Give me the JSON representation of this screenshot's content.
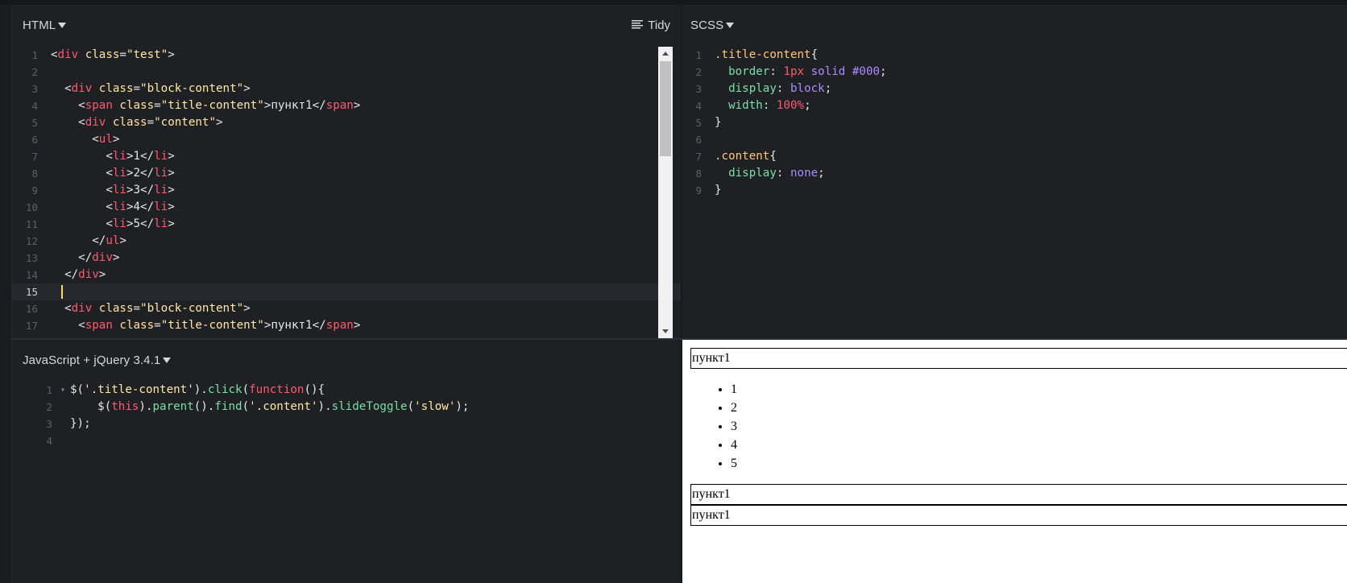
{
  "html_pane": {
    "language_label": "HTML",
    "tidy_label": "Tidy",
    "lines": [
      {
        "n": "1",
        "segs": [
          [
            "p",
            "<"
          ],
          [
            "tag",
            "div"
          ],
          [
            "attr",
            " class"
          ],
          [
            "p",
            "="
          ],
          [
            "str",
            "\"test\""
          ],
          [
            "p",
            ">"
          ]
        ]
      },
      {
        "n": "2",
        "segs": []
      },
      {
        "n": "3",
        "segs": [
          [
            "p",
            "  <"
          ],
          [
            "tag",
            "div"
          ],
          [
            "attr",
            " class"
          ],
          [
            "p",
            "="
          ],
          [
            "str",
            "\"block-content\""
          ],
          [
            "p",
            ">"
          ]
        ]
      },
      {
        "n": "4",
        "segs": [
          [
            "p",
            "    <"
          ],
          [
            "tag",
            "span"
          ],
          [
            "attr",
            " class"
          ],
          [
            "p",
            "="
          ],
          [
            "str",
            "\"title-content\""
          ],
          [
            "p",
            ">пункт1</"
          ],
          [
            "tag",
            "span"
          ],
          [
            "p",
            ">"
          ]
        ]
      },
      {
        "n": "5",
        "segs": [
          [
            "p",
            "    <"
          ],
          [
            "tag",
            "div"
          ],
          [
            "attr",
            " class"
          ],
          [
            "p",
            "="
          ],
          [
            "str",
            "\"content\""
          ],
          [
            "p",
            ">"
          ]
        ]
      },
      {
        "n": "6",
        "segs": [
          [
            "p",
            "      <"
          ],
          [
            "tag",
            "ul"
          ],
          [
            "p",
            ">"
          ]
        ]
      },
      {
        "n": "7",
        "segs": [
          [
            "p",
            "        <"
          ],
          [
            "tag",
            "li"
          ],
          [
            "p",
            ">1</"
          ],
          [
            "tag",
            "li"
          ],
          [
            "p",
            ">"
          ]
        ]
      },
      {
        "n": "8",
        "segs": [
          [
            "p",
            "        <"
          ],
          [
            "tag",
            "li"
          ],
          [
            "p",
            ">2</"
          ],
          [
            "tag",
            "li"
          ],
          [
            "p",
            ">"
          ]
        ]
      },
      {
        "n": "9",
        "segs": [
          [
            "p",
            "        <"
          ],
          [
            "tag",
            "li"
          ],
          [
            "p",
            ">3</"
          ],
          [
            "tag",
            "li"
          ],
          [
            "p",
            ">"
          ]
        ]
      },
      {
        "n": "10",
        "segs": [
          [
            "p",
            "        <"
          ],
          [
            "tag",
            "li"
          ],
          [
            "p",
            ">4</"
          ],
          [
            "tag",
            "li"
          ],
          [
            "p",
            ">"
          ]
        ]
      },
      {
        "n": "11",
        "segs": [
          [
            "p",
            "        <"
          ],
          [
            "tag",
            "li"
          ],
          [
            "p",
            ">5</"
          ],
          [
            "tag",
            "li"
          ],
          [
            "p",
            ">"
          ]
        ]
      },
      {
        "n": "12",
        "segs": [
          [
            "p",
            "      </"
          ],
          [
            "tag",
            "ul"
          ],
          [
            "p",
            ">"
          ]
        ]
      },
      {
        "n": "13",
        "segs": [
          [
            "p",
            "    </"
          ],
          [
            "tag",
            "div"
          ],
          [
            "p",
            ">"
          ]
        ]
      },
      {
        "n": "14",
        "segs": [
          [
            "p",
            "  </"
          ],
          [
            "tag",
            "div"
          ],
          [
            "p",
            ">"
          ]
        ]
      },
      {
        "n": "15",
        "segs": [],
        "active": true
      },
      {
        "n": "16",
        "segs": [
          [
            "p",
            "  <"
          ],
          [
            "tag",
            "div"
          ],
          [
            "attr",
            " class"
          ],
          [
            "p",
            "="
          ],
          [
            "str",
            "\"block-content\""
          ],
          [
            "p",
            ">"
          ]
        ]
      },
      {
        "n": "17",
        "segs": [
          [
            "p",
            "    <"
          ],
          [
            "tag",
            "span"
          ],
          [
            "attr",
            " class"
          ],
          [
            "p",
            "="
          ],
          [
            "str",
            "\"title-content\""
          ],
          [
            "p",
            ">пункт1</"
          ],
          [
            "tag",
            "span"
          ],
          [
            "p",
            ">"
          ]
        ]
      }
    ]
  },
  "css_pane": {
    "language_label": "SCSS",
    "lines": [
      {
        "n": "1",
        "segs": [
          [
            "sel",
            ".title-content"
          ],
          [
            "p",
            "{"
          ]
        ]
      },
      {
        "n": "2",
        "segs": [
          [
            "p",
            "  "
          ],
          [
            "prop",
            "border"
          ],
          [
            "p",
            ": "
          ],
          [
            "num",
            "1px"
          ],
          [
            "p",
            " "
          ],
          [
            "kw",
            "solid"
          ],
          [
            "p",
            " "
          ],
          [
            "hex",
            "#000"
          ],
          [
            "p",
            ";"
          ]
        ]
      },
      {
        "n": "3",
        "segs": [
          [
            "p",
            "  "
          ],
          [
            "prop",
            "display"
          ],
          [
            "p",
            ": "
          ],
          [
            "kw",
            "block"
          ],
          [
            "p",
            ";"
          ]
        ]
      },
      {
        "n": "4",
        "segs": [
          [
            "p",
            "  "
          ],
          [
            "prop",
            "width"
          ],
          [
            "p",
            ": "
          ],
          [
            "num",
            "100%"
          ],
          [
            "p",
            ";"
          ]
        ]
      },
      {
        "n": "5",
        "segs": [
          [
            "p",
            "}"
          ]
        ]
      },
      {
        "n": "6",
        "segs": []
      },
      {
        "n": "7",
        "segs": [
          [
            "sel",
            ".content"
          ],
          [
            "p",
            "{"
          ]
        ]
      },
      {
        "n": "8",
        "segs": [
          [
            "p",
            "  "
          ],
          [
            "prop",
            "display"
          ],
          [
            "p",
            ": "
          ],
          [
            "kw",
            "none"
          ],
          [
            "p",
            ";"
          ]
        ]
      },
      {
        "n": "9",
        "segs": [
          [
            "p",
            "}"
          ]
        ]
      }
    ]
  },
  "js_pane": {
    "language_label": "JavaScript + jQuery 3.4.1",
    "lines": [
      {
        "n": "1",
        "fold": "▾",
        "segs": [
          [
            "js",
            "$("
          ],
          [
            "str",
            "'.title-content'"
          ],
          [
            "js",
            ")."
          ],
          [
            "fn",
            "click"
          ],
          [
            "js",
            "("
          ],
          [
            "key",
            "function"
          ],
          [
            "js",
            "(){"
          ]
        ]
      },
      {
        "n": "2",
        "segs": [
          [
            "js",
            "    $("
          ],
          [
            "key",
            "this"
          ],
          [
            "js",
            ")."
          ],
          [
            "fn",
            "parent"
          ],
          [
            "js",
            "()."
          ],
          [
            "fn",
            "find"
          ],
          [
            "js",
            "("
          ],
          [
            "str",
            "'.content'"
          ],
          [
            "js",
            ")."
          ],
          [
            "fn",
            "slideToggle"
          ],
          [
            "js",
            "("
          ],
          [
            "str",
            "'slow'"
          ],
          [
            "js",
            ");"
          ]
        ]
      },
      {
        "n": "3",
        "segs": [
          [
            "js",
            "});"
          ]
        ]
      },
      {
        "n": "4",
        "segs": []
      }
    ]
  },
  "result": {
    "blocks": [
      {
        "title": "пункт1",
        "items": [
          "1",
          "2",
          "3",
          "4",
          "5"
        ]
      },
      {
        "title": "пункт1",
        "items": []
      },
      {
        "title": "пункт1",
        "items": []
      }
    ]
  }
}
